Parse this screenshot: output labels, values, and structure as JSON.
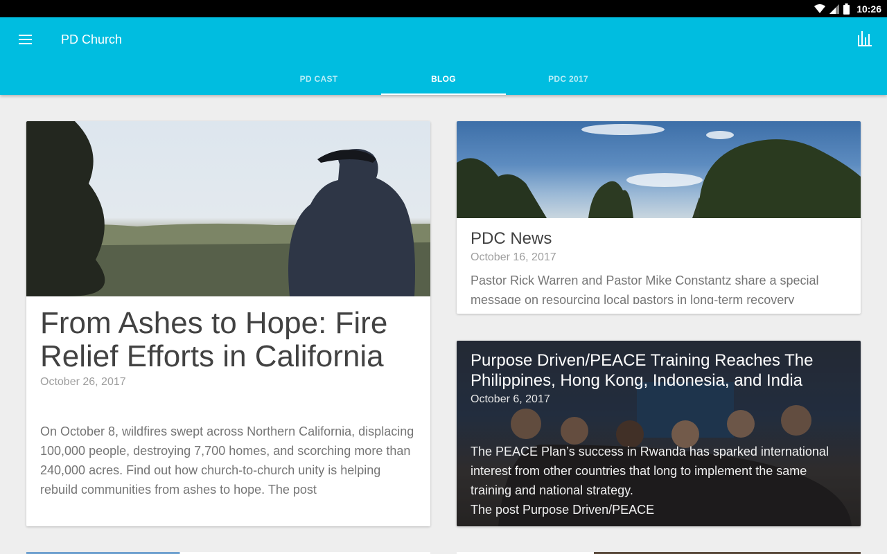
{
  "status_bar": {
    "time": "10:26",
    "icons": [
      "wifi-icon",
      "cell-signal-icon",
      "battery-icon"
    ]
  },
  "app_bar": {
    "title": "PD Church",
    "menu_icon": "hamburger-menu-icon",
    "action_icon": "equalizer-icon",
    "color": "#00bde0"
  },
  "tabs": [
    {
      "label": "PD CAST",
      "active": false
    },
    {
      "label": "BLOG",
      "active": true
    },
    {
      "label": "PDC 2017",
      "active": false
    }
  ],
  "posts": {
    "featured": {
      "title": "From Ashes to Hope: Fire Relief Efforts in California",
      "date": "October 26, 2017",
      "excerpt": "On October 8, wildfires swept across Northern California, displacing 100,000 people, destroying 7,700 homes, and scorching more than 240,000 acres. Find out how church-to-church unity is helping rebuild communities from ashes to hope. The post"
    },
    "news": {
      "title": "PDC News",
      "date": "October 16, 2017",
      "excerpt": "Pastor Rick Warren and Pastor Mike Constantz share a special message on resourcing local pastors in long-term recovery"
    },
    "peace": {
      "title": "Purpose Driven/PEACE Training Reaches The Philippines, Hong Kong, Indonesia, and India",
      "date": "October 6, 2017",
      "excerpt": "The PEACE Plan’s success in Rwanda has sparked international interest from other countries that long to implement the same training and national strategy.",
      "excerpt_tail": "The post Purpose Driven/PEACE"
    }
  }
}
